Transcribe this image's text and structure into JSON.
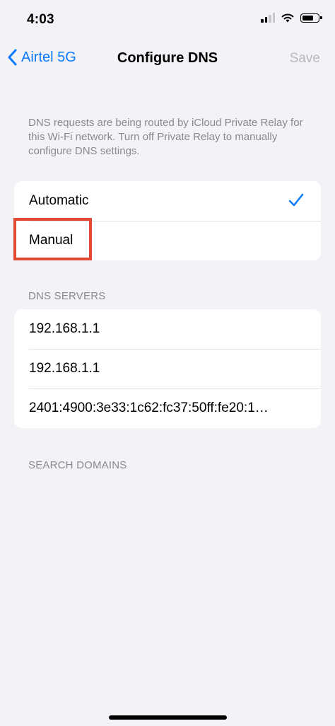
{
  "status_bar": {
    "time": "4:03"
  },
  "nav": {
    "back_label": "Airtel 5G",
    "title": "Configure DNS",
    "save_label": "Save"
  },
  "note": "DNS requests are being routed by iCloud Private Relay for this Wi-Fi network. Turn off Private Relay to manually configure DNS settings.",
  "mode_options": [
    {
      "label": "Automatic",
      "selected": true
    },
    {
      "label": "Manual",
      "selected": false
    }
  ],
  "dns_servers": {
    "header": "DNS SERVERS",
    "items": [
      "192.168.1.1",
      "192.168.1.1",
      "2401:4900:3e33:1c62:fc37:50ff:fe20:1…"
    ]
  },
  "search_domains": {
    "header": "SEARCH DOMAINS"
  },
  "colors": {
    "accent": "#0a7aff",
    "highlight": "#e24a33",
    "background": "#f2f2f7",
    "disabled": "#b9b9bd"
  },
  "icons": {
    "back": "chevron-left-icon",
    "check": "checkmark-icon",
    "signal": "cellular-signal-icon",
    "wifi": "wifi-icon",
    "battery": "battery-icon"
  }
}
